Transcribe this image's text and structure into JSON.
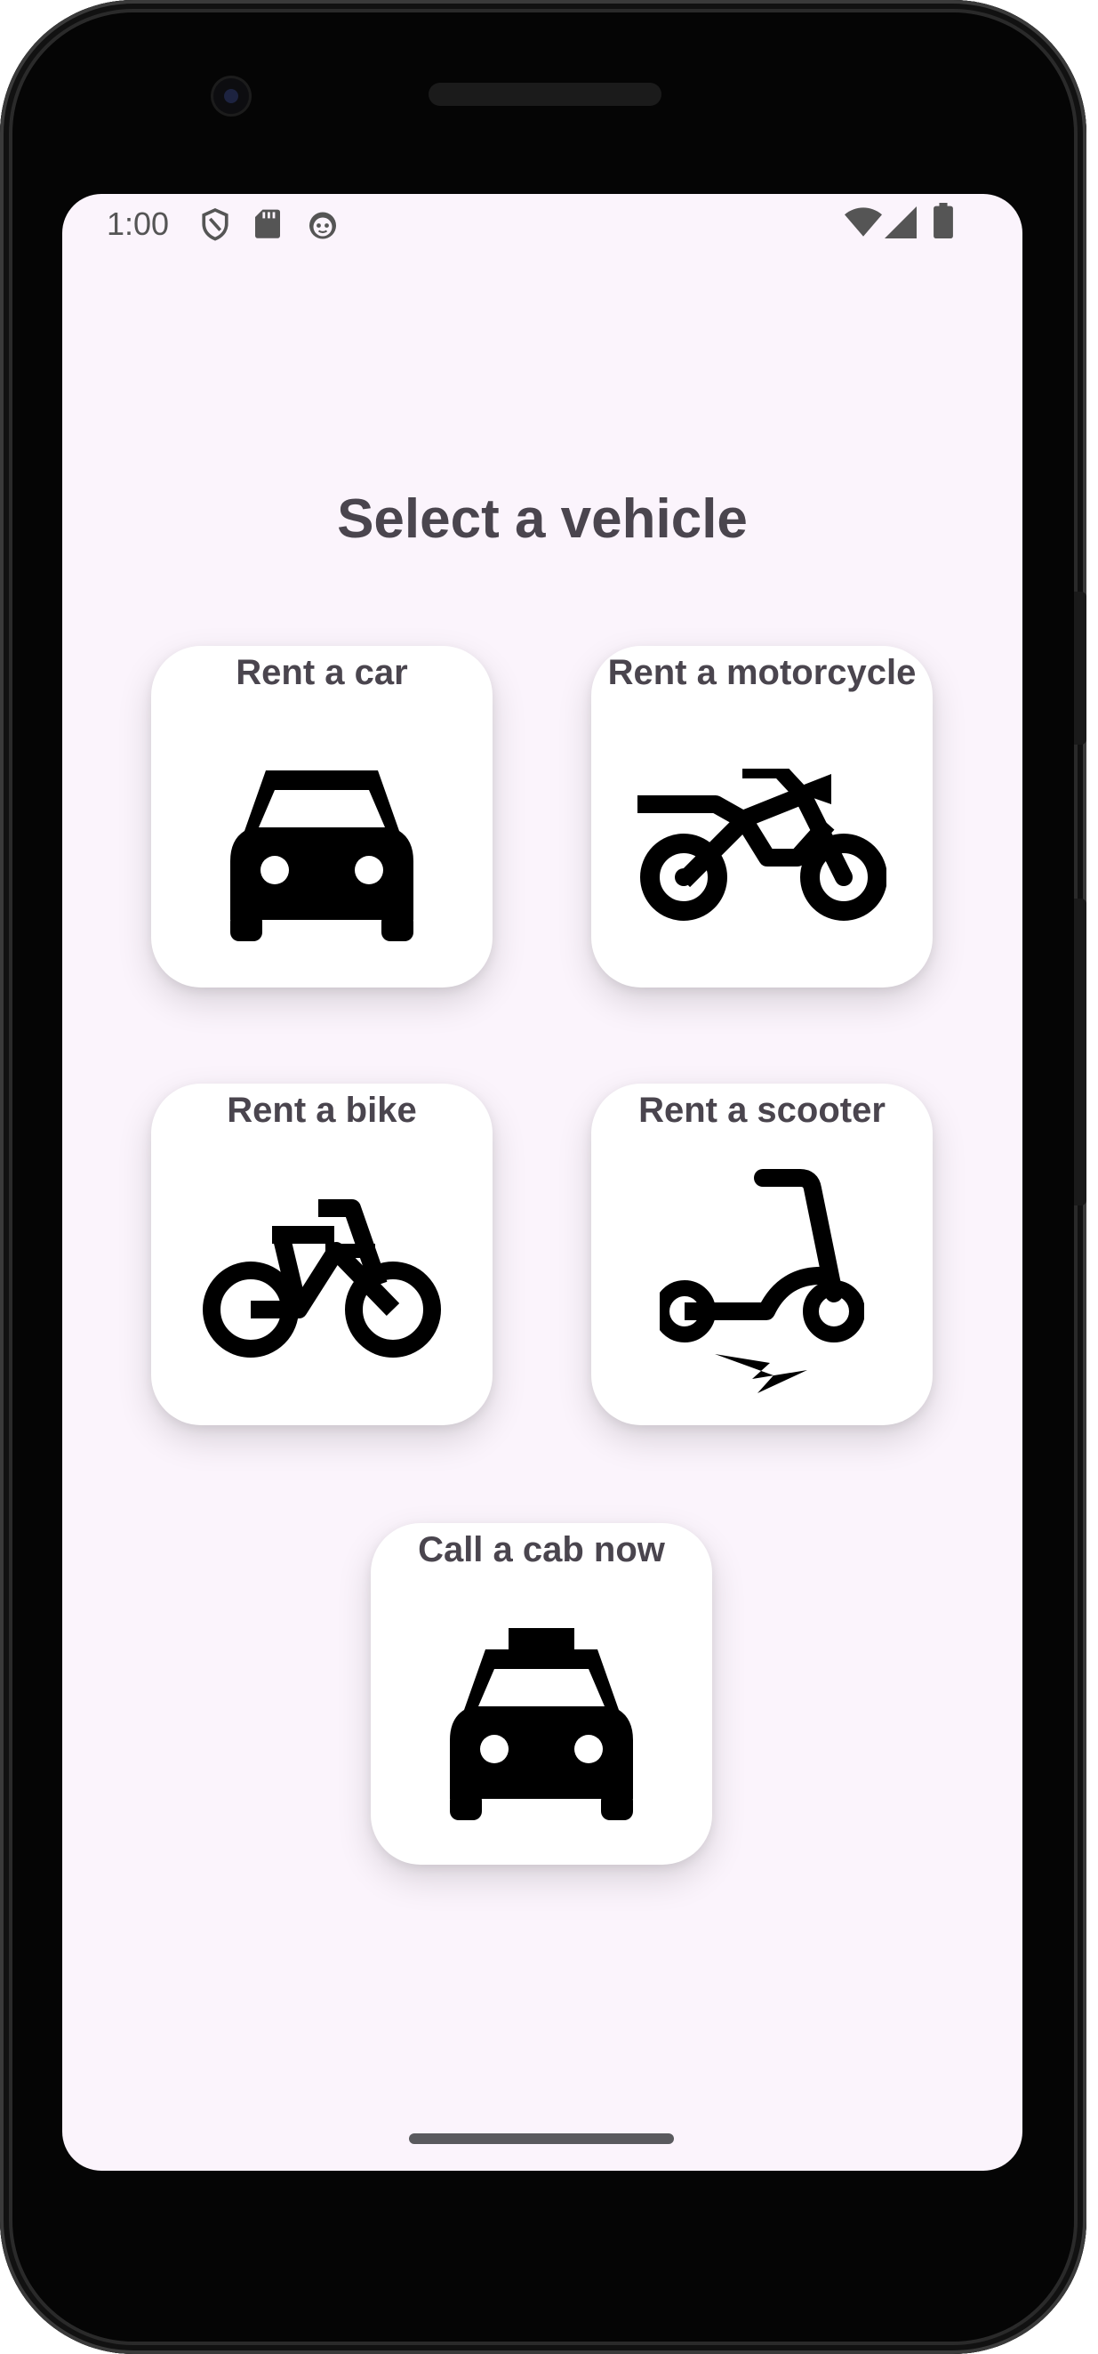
{
  "status_bar": {
    "time": "1:00",
    "left_icons": [
      "shield-icon",
      "sd-card-icon",
      "face-icon"
    ],
    "right_icons": [
      "wifi-icon",
      "signal-icon",
      "battery-icon"
    ]
  },
  "main": {
    "title": "Select a vehicle",
    "options": [
      {
        "label": "Rent a car",
        "icon": "car-icon"
      },
      {
        "label": "Rent a motorcycle",
        "icon": "motorcycle-icon"
      },
      {
        "label": "Rent a bike",
        "icon": "bike-icon"
      },
      {
        "label": "Rent a scooter",
        "icon": "scooter-icon"
      },
      {
        "label": "Call a cab now",
        "icon": "taxi-icon"
      }
    ]
  },
  "colors": {
    "screen_background": "#fbf4fc",
    "card_background": "#ffffff",
    "text": "#4a454e",
    "icon": "#000000"
  }
}
